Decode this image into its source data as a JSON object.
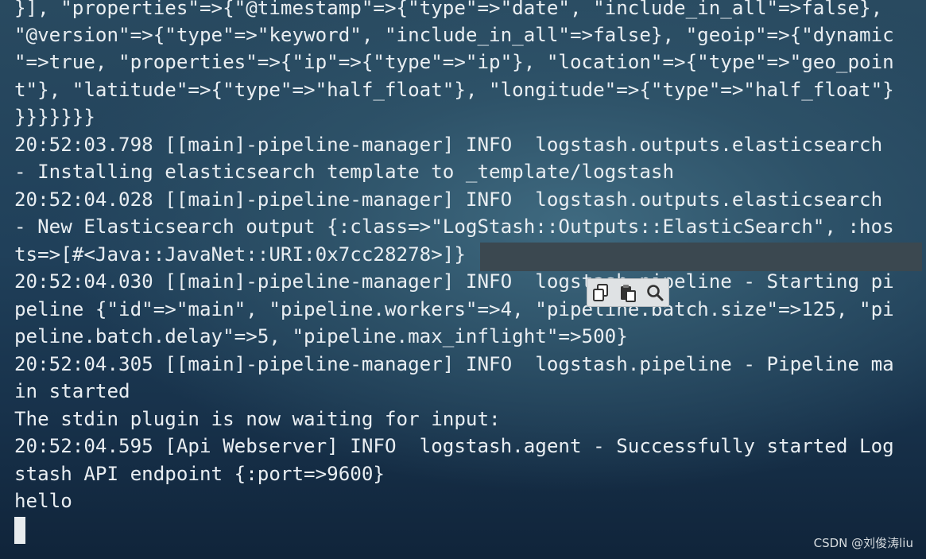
{
  "terminal": {
    "lines": [
      "}], \"properties\"=>{\"@timestamp\"=>{\"type\"=>\"date\", \"include_in_all\"=>false},",
      "\"@version\"=>{\"type\"=>\"keyword\", \"include_in_all\"=>false}, \"geoip\"=>{\"dynamic",
      "\"=>true, \"properties\"=>{\"ip\"=>{\"type\"=>\"ip\"}, \"location\"=>{\"type\"=>\"geo_poin",
      "t\"}, \"latitude\"=>{\"type\"=>\"half_float\"}, \"longitude\"=>{\"type\"=>\"half_float\"}",
      "}}}}}}}",
      "20:52:03.798 [[main]-pipeline-manager] INFO  logstash.outputs.elasticsearch",
      "- Installing elasticsearch template to _template/logstash",
      "20:52:04.028 [[main]-pipeline-manager] INFO  logstash.outputs.elasticsearch",
      "- New Elasticsearch output {:class=>\"LogStash::Outputs::ElasticSearch\", :hos",
      "ts=>[#<Java::JavaNet::URI:0x7cc28278>]}",
      "20:52:04.030 [[main]-pipeline-manager] INFO  logstash.pipeline - Starting pi",
      "peline {\"id\"=>\"main\", \"pipeline.workers\"=>4, \"pipeline.batch.size\"=>125, \"pi",
      "peline.batch.delay\"=>5, \"pipeline.max_inflight\"=>500}",
      "20:52:04.305 [[main]-pipeline-manager] INFO  logstash.pipeline - Pipeline ma",
      "in started",
      "The stdin plugin is now waiting for input:",
      "20:52:04.595 [Api Webserver] INFO  logstash.agent - Successfully started Log",
      "stash API endpoint {:port=>9600}",
      "hello"
    ]
  },
  "toolbar": {
    "icons": [
      "copy-icon",
      "paste-icon",
      "search-icon"
    ]
  },
  "watermark": "CSDN @刘俊涛liu",
  "colors": {
    "text": "#e9eef2",
    "selection": "#3b4850",
    "toolbar_bg": "#dfe2e4"
  }
}
